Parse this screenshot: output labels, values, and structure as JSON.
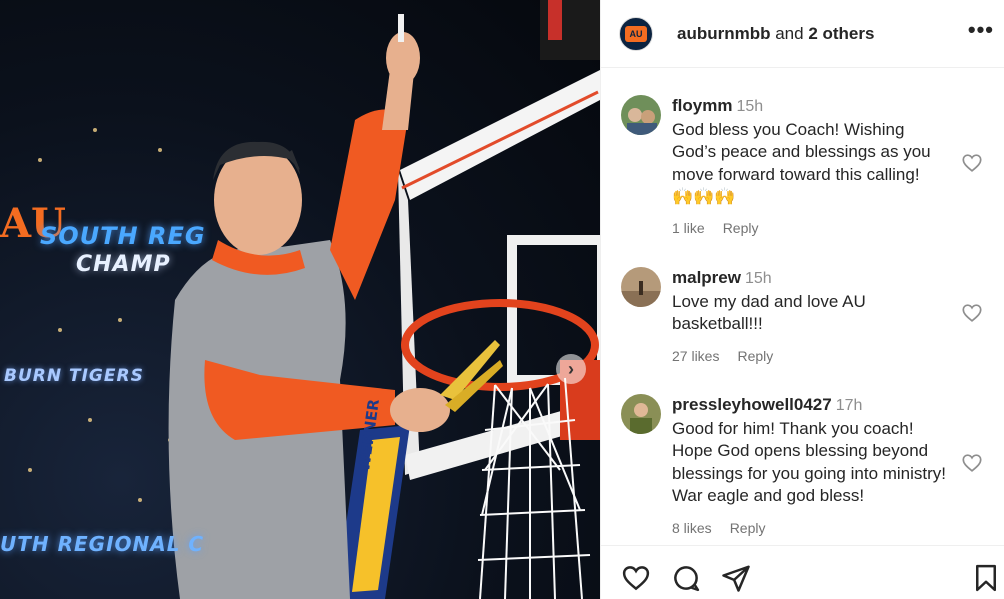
{
  "photo": {
    "banner_line1": "SOUTH REG",
    "banner_line2": "CHAMP",
    "banner_line3": "BURN TIGERS",
    "banner_line4": "UTH REGIONAL C",
    "logo_text": "AU",
    "stanchion_text": "WERNER",
    "next_icon": "chevron-right-icon",
    "next_glyph": "›"
  },
  "header": {
    "username": "auburnmbb",
    "joiner": " and ",
    "others": "2 others",
    "avatar_text": "AU",
    "more_glyph": "•••"
  },
  "comments": [
    {
      "username": "floymm",
      "time": "15h",
      "text": "God bless you Coach! Wishing God’s peace and blessings as you move forward toward this calling!",
      "emoji": "🙌🙌🙌",
      "likes": "1 like",
      "reply": "Reply"
    },
    {
      "username": "malprew",
      "time": "15h",
      "text": "Love my dad and love AU basketball!!!",
      "emoji": "",
      "likes": "27 likes",
      "reply": "Reply"
    },
    {
      "username": "pressleyhowell0427",
      "time": "17h",
      "text": "Good for him! Thank you coach! Hope God opens blessing beyond blessings for you going into ministry! War eagle and god bless!",
      "emoji": "",
      "likes": "8 likes",
      "reply": "Reply"
    }
  ],
  "colors": {
    "orange": "#f36c21",
    "navy": "#0c2340",
    "muted": "#737373"
  }
}
